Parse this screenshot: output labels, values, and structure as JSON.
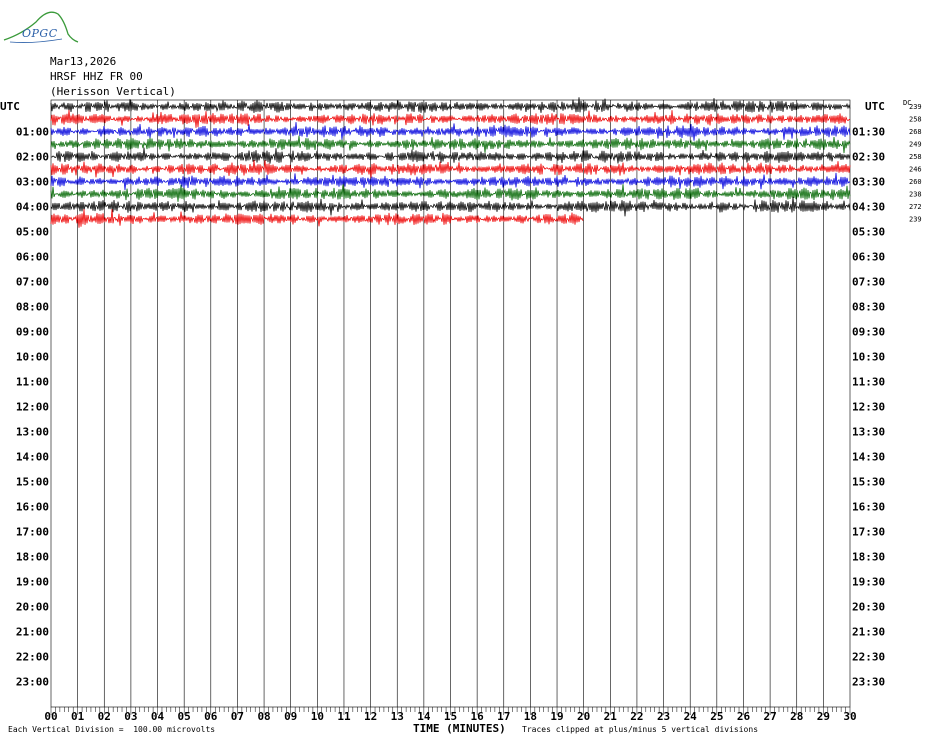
{
  "logo": {
    "text": "OPGC"
  },
  "header": {
    "date": "Mar13,2026",
    "channel": "HRSF HHZ FR 00",
    "station": "(Herisson Vertical)"
  },
  "axis": {
    "left_title": "UTC",
    "right_title": "UTC",
    "dc_title": "DC",
    "xlabel": "TIME (MINUTES)"
  },
  "footer": {
    "left": "Each Vertical Division =  100.00 microvolts",
    "right": "Traces clipped at plus/minus 5 vertical divisions"
  },
  "colors": {
    "black": "#000000",
    "red": "#ee0000",
    "blue": "#0000dd",
    "green": "#006600",
    "grid": "#000000"
  },
  "chart_data": {
    "type": "line",
    "title": "HRSF HHZ FR 00 (Herisson Vertical)",
    "xlabel": "TIME (MINUTES)",
    "xlim": [
      0,
      30
    ],
    "x_ticks": [
      "00",
      "01",
      "02",
      "03",
      "04",
      "05",
      "06",
      "07",
      "08",
      "09",
      "10",
      "11",
      "12",
      "13",
      "14",
      "15",
      "16",
      "17",
      "18",
      "19",
      "20",
      "21",
      "22",
      "23",
      "24",
      "25",
      "26",
      "27",
      "28",
      "29",
      "30"
    ],
    "left_labels": [
      "01:00",
      "02:00",
      "03:00",
      "04:00",
      "05:00",
      "06:00",
      "07:00",
      "08:00",
      "09:00",
      "10:00",
      "11:00",
      "12:00",
      "13:00",
      "14:00",
      "15:00",
      "16:00",
      "17:00",
      "18:00",
      "19:00",
      "20:00",
      "21:00",
      "22:00",
      "23:00"
    ],
    "right_labels": [
      "01:30",
      "02:30",
      "03:30",
      "04:30",
      "05:30",
      "06:30",
      "07:30",
      "08:30",
      "09:30",
      "10:30",
      "11:30",
      "12:30",
      "13:30",
      "14:30",
      "15:30",
      "16:30",
      "17:30",
      "18:30",
      "19:30",
      "20:30",
      "21:30",
      "22:30",
      "23:30"
    ],
    "traces": [
      {
        "start": "00:00",
        "color": "black",
        "dc": "239",
        "minutes": 30
      },
      {
        "start": "00:30",
        "color": "red",
        "dc": "258",
        "minutes": 30
      },
      {
        "start": "01:00",
        "color": "blue",
        "dc": "268",
        "minutes": 30
      },
      {
        "start": "01:30",
        "color": "green",
        "dc": "249",
        "minutes": 30
      },
      {
        "start": "02:00",
        "color": "black",
        "dc": "258",
        "minutes": 30
      },
      {
        "start": "02:30",
        "color": "red",
        "dc": "246",
        "minutes": 30
      },
      {
        "start": "03:00",
        "color": "blue",
        "dc": "260",
        "minutes": 30
      },
      {
        "start": "03:30",
        "color": "green",
        "dc": "238",
        "minutes": 30
      },
      {
        "start": "04:00",
        "color": "black",
        "dc": "272",
        "minutes": 30
      },
      {
        "start": "04:30",
        "color": "red",
        "dc": "239",
        "minutes": 20
      }
    ]
  }
}
